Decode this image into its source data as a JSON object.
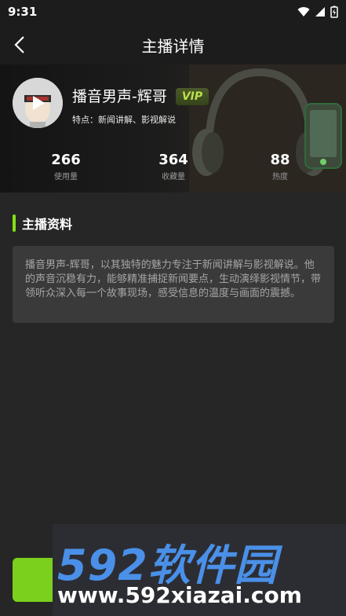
{
  "status_bar": {
    "time": "9:31"
  },
  "nav": {
    "title": "主播详情"
  },
  "anchor": {
    "name": "播音男声-辉哥",
    "vip": "VIP",
    "features": "特点：新闻讲解、影视解说"
  },
  "stats": [
    {
      "value": "266",
      "label": "使用量"
    },
    {
      "value": "364",
      "label": "收藏量"
    },
    {
      "value": "88",
      "label": "热度"
    }
  ],
  "section": {
    "title": "主播资料"
  },
  "profile": {
    "text": "播音男声-辉哥，以其独特的魅力专注于新闻讲解与影视解说。他的声音沉稳有力，能够精准捕捉新闻要点，生动演绎影视情节，带领听众深入每一个故事现场，感受信息的温度与画面的震撼。"
  },
  "watermark": {
    "logo": "592软件园",
    "url": "www.592xiazai.com"
  },
  "colors": {
    "accent": "#84e017",
    "background": "#262626",
    "card": "#3a3a3a"
  }
}
